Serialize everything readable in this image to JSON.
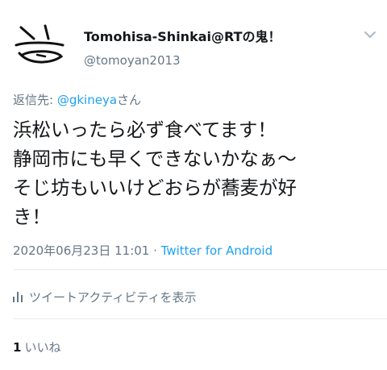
{
  "header": {
    "display_name": "Tomohisa-Shinkai@RTの鬼！",
    "handle": "@tomoyan2013"
  },
  "reply": {
    "prefix": "返信先: ",
    "mention": "@gkineya",
    "suffix": "さん"
  },
  "tweet": {
    "lines": [
      "浜松いったら必ず食べてます！",
      "静岡市にも早くできないかなぁ〜",
      "そじ坊もいいけどおらが蕎麦が好",
      "き！"
    ]
  },
  "meta": {
    "timestamp": "2020年06月23日 11:01",
    "separator": " · ",
    "source": "Twitter for Android"
  },
  "activity": {
    "label": "ツイートアクティビティを表示",
    "icon": "bar-chart-icon"
  },
  "likes": {
    "count": "1",
    "label": "いいね"
  },
  "colors": {
    "text": "#14171a",
    "secondary": "#657786",
    "link": "#1da1f2",
    "divider": "#e6ecf0"
  }
}
